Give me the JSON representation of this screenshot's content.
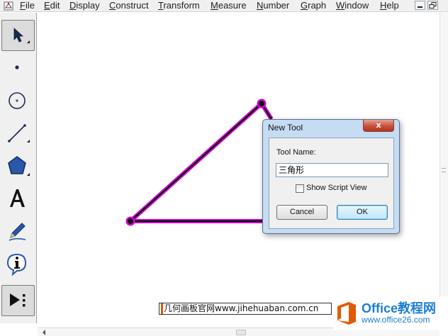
{
  "menubar": {
    "items": [
      "File",
      "Edit",
      "Display",
      "Construct",
      "Transform",
      "Measure",
      "Number",
      "Graph",
      "Window",
      "Help"
    ],
    "underline": [
      "F",
      "E",
      "D",
      "C",
      "T",
      "M",
      "N",
      "G",
      "W",
      "H"
    ],
    "rest": [
      "ile",
      "dit",
      "isplay",
      "onstruct",
      "ransform",
      "easure",
      "umber",
      "raph",
      "indow",
      "elp"
    ],
    "window_buttons": [
      "minimize",
      "restore"
    ]
  },
  "toolbox": {
    "tools": [
      {
        "name": "arrow-tool",
        "icon": "arrow-icon",
        "selected": true
      },
      {
        "name": "point-tool",
        "icon": "point-icon"
      },
      {
        "name": "compass-tool",
        "icon": "circle-icon"
      },
      {
        "name": "straightedge-tool",
        "icon": "segment-icon"
      },
      {
        "name": "polygon-tool",
        "icon": "pentagon-icon"
      },
      {
        "name": "text-tool",
        "icon": "text-a-icon",
        "glyph": "A"
      },
      {
        "name": "marker-tool",
        "icon": "pen-icon"
      },
      {
        "name": "information-tool",
        "icon": "info-icon",
        "glyph": "i"
      },
      {
        "name": "custom-tools",
        "icon": "custom-tool-icon",
        "selected": true
      }
    ]
  },
  "canvas": {
    "figure": "triangle",
    "points": 3,
    "highlight_color": "#d400d4",
    "stroke_color": "#000000"
  },
  "dialog": {
    "title": "New Tool",
    "close_label": "x",
    "tool_name_label": "Tool Name:",
    "tool_name_value": "三角形",
    "show_script_view_label": "Show Script View",
    "show_script_view_checked": false,
    "cancel_label": "Cancel",
    "ok_label": "OK"
  },
  "watermarks": {
    "site_text": "几何画板官网www.jihehuaban.com.cn",
    "logo_name": "Office教程网",
    "logo_url": "www.office26.com",
    "logo_color": "#1d7fd0",
    "logo_accent": "#e25a00"
  }
}
